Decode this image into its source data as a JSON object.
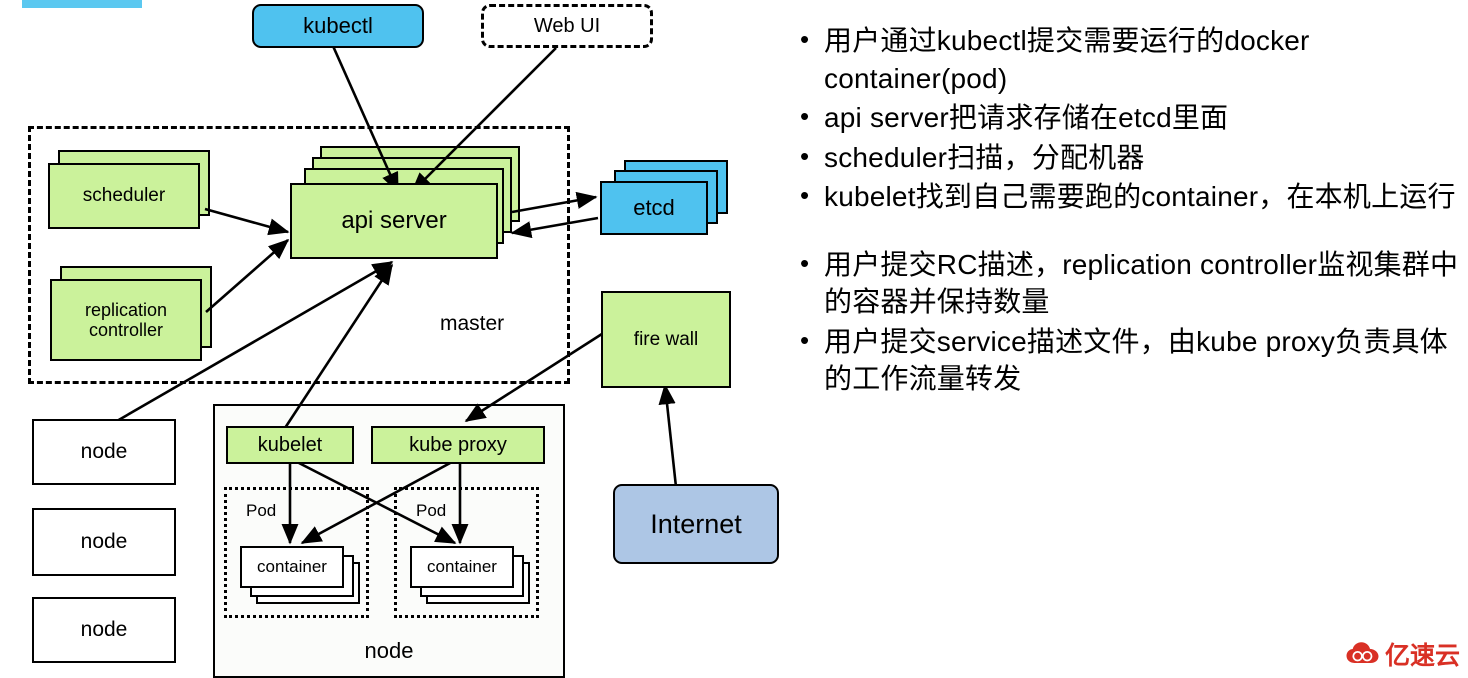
{
  "diagram": {
    "title": "Kubernetes architecture",
    "colors": {
      "green": "#cbf29b",
      "blue": "#4fc2ef",
      "steel_blue": "#adc6e5",
      "white": "#ffffff",
      "line": "#000000",
      "accent_bar": "#5bc8f0",
      "watermark_red": "#d93025"
    },
    "clients": {
      "kubectl": "kubectl",
      "web_ui": "Web UI"
    },
    "master": {
      "label": "master",
      "scheduler": "scheduler",
      "replication_controller": "replication\ncontroller",
      "replication_controller_line1": "replication",
      "replication_controller_line2": "controller",
      "api_server": "api server"
    },
    "etcd": "etcd",
    "fire_wall": "fire wall",
    "internet": "Internet",
    "nodes_left": [
      "node",
      "node",
      "node"
    ],
    "worker_node": {
      "label": "node",
      "kubelet": "kubelet",
      "kube_proxy": "kube proxy",
      "pods": [
        {
          "label": "Pod",
          "container": "container"
        },
        {
          "label": "Pod",
          "container": "container"
        }
      ]
    }
  },
  "notes": {
    "group_one": [
      "用户通过kubectl提交需要运行的docker container(pod)",
      "api server把请求存储在etcd里面",
      "scheduler扫描，分配机器",
      "kubelet找到自己需要跑的container，在本机上运行"
    ],
    "group_two": [
      "用户提交RC描述，replication controller监视集群中的容器并保持数量",
      "用户提交service描述文件，由kube proxy负责具体的工作流量转发"
    ],
    "bullet": "•"
  },
  "watermark": {
    "text": "亿速云"
  }
}
